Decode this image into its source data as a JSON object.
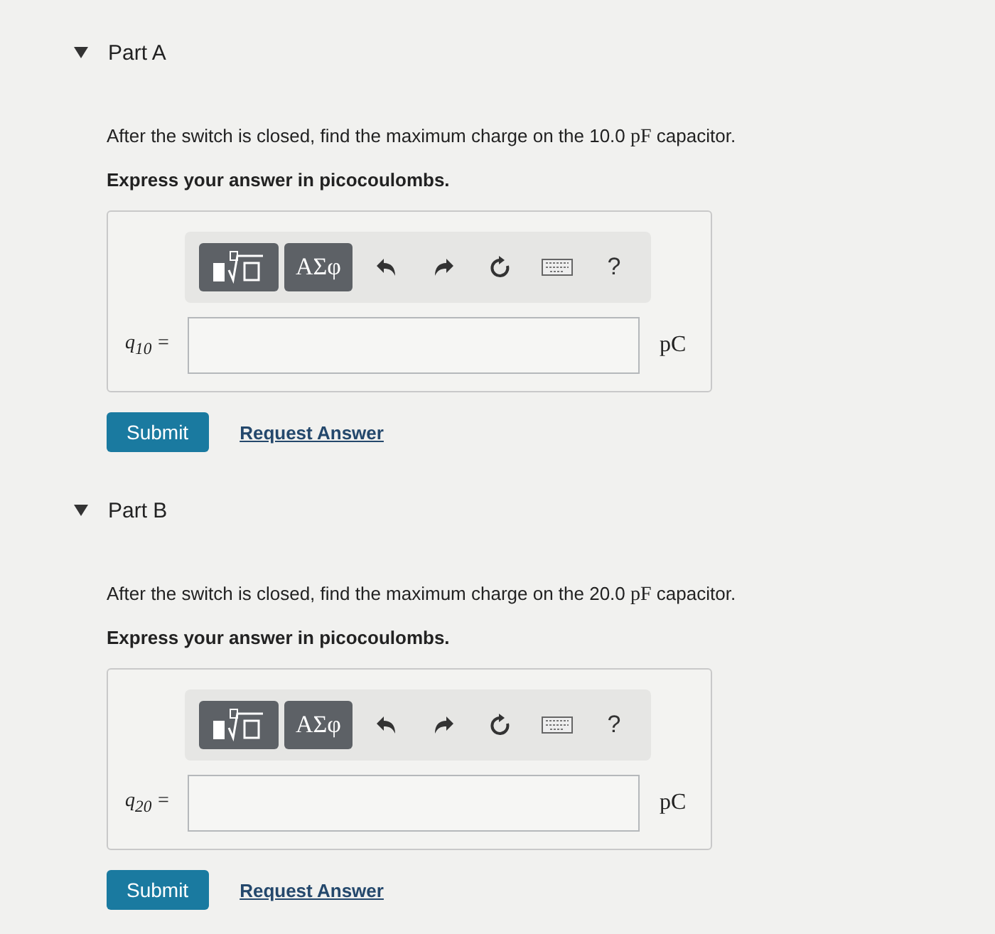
{
  "parts": [
    {
      "title": "Part A",
      "expanded": true,
      "question": {
        "before": "After the switch is closed, find the maximum charge on the 10.0 ",
        "unit": "pF",
        "after": " capacitor."
      },
      "instruction": "Express your answer in picocoulombs.",
      "toolbar": {
        "symbols": "ΑΣφ",
        "help": "?"
      },
      "variable": "q$_{10}$ =",
      "units": "pC",
      "submit": "Submit",
      "request": "Request Answer"
    },
    {
      "title": "Part B",
      "expanded": true,
      "question": {
        "before": "After the switch is closed, find the maximum charge on the 20.0 ",
        "unit": "pF",
        "after": " capacitor."
      },
      "instruction": "Express your answer in picocoulombs.",
      "toolbar": {
        "symbols": "ΑΣφ",
        "help": "?"
      },
      "variable": "q$_{20}$ =",
      "units": "pC",
      "submit": "Submit",
      "request": "Request Answer"
    }
  ]
}
